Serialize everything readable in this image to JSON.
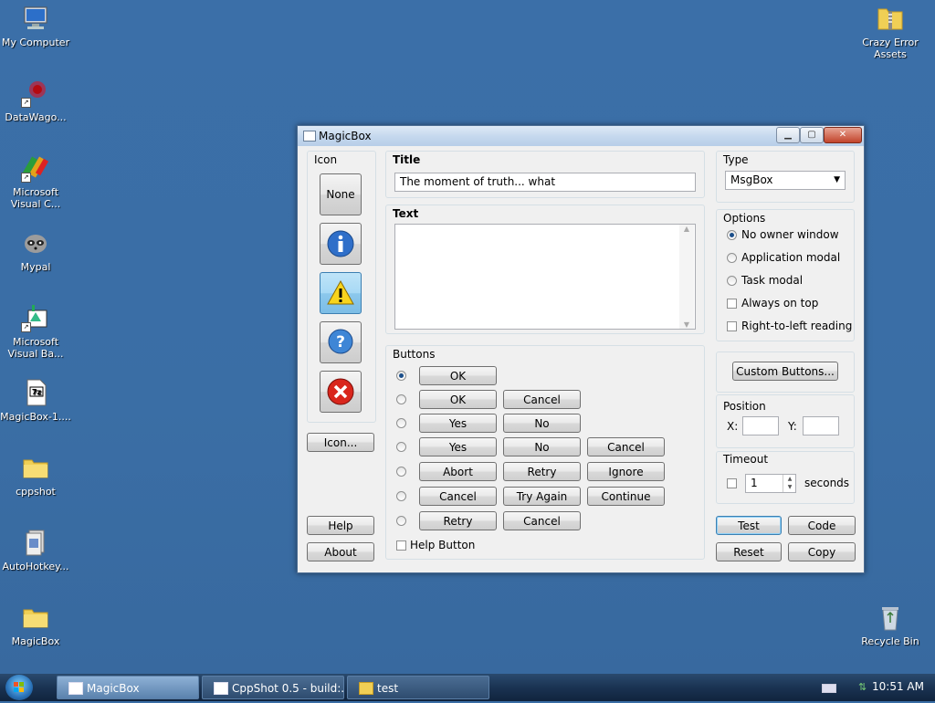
{
  "desktop": {
    "icons": [
      {
        "label": "My Computer",
        "icon": "computer-icon"
      },
      {
        "label": "DataWago...",
        "icon": "datawagon-icon"
      },
      {
        "label": "Microsoft Visual C...",
        "icon": "visual-c-icon"
      },
      {
        "label": "Mypal",
        "icon": "raccoon-icon"
      },
      {
        "label": "Microsoft Visual Ba...",
        "icon": "visual-basic-icon"
      },
      {
        "label": "MagicBox-1....",
        "icon": "7z-archive-icon"
      },
      {
        "label": "cppshot",
        "icon": "folder-icon"
      },
      {
        "label": "AutoHotkey...",
        "icon": "autohotkey-icon"
      },
      {
        "label": "MagicBox",
        "icon": "folder-icon"
      },
      {
        "label": "Crazy Error Assets",
        "icon": "zip-folder-icon"
      },
      {
        "label": "Recycle Bin",
        "icon": "recycle-bin-icon"
      }
    ]
  },
  "window": {
    "title": "MagicBox",
    "icon_group": {
      "label": "Icon",
      "none_label": "None",
      "icon_button_label": "Icon...",
      "help_label": "Help",
      "about_label": "About"
    },
    "title_field": {
      "label": "Title",
      "value": "The moment of truth... what"
    },
    "text_field": {
      "label": "Text",
      "value": ""
    },
    "buttons_group": {
      "label": "Buttons",
      "rows": [
        {
          "b1": "OK",
          "b2": "",
          "b3": ""
        },
        {
          "b1": "OK",
          "b2": "Cancel",
          "b3": ""
        },
        {
          "b1": "Yes",
          "b2": "No",
          "b3": ""
        },
        {
          "b1": "Yes",
          "b2": "No",
          "b3": "Cancel"
        },
        {
          "b1": "Abort",
          "b2": "Retry",
          "b3": "Ignore"
        },
        {
          "b1": "Cancel",
          "b2": "Try Again",
          "b3": "Continue"
        },
        {
          "b1": "Retry",
          "b2": "Cancel",
          "b3": ""
        }
      ],
      "help_button_label": "Help Button"
    },
    "type_group": {
      "label": "Type",
      "selected": "MsgBox"
    },
    "options_group": {
      "label": "Options",
      "no_owner": "No owner window",
      "app_modal": "Application modal",
      "task_modal": "Task modal",
      "always_on_top": "Always on top",
      "rtl": "Right-to-left reading"
    },
    "custom_buttons_label": "Custom Buttons...",
    "position_group": {
      "label": "Position",
      "x_label": "X:",
      "y_label": "Y:",
      "x_value": "",
      "y_value": ""
    },
    "timeout_group": {
      "label": "Timeout",
      "value": "1",
      "unit": "seconds"
    },
    "actions": {
      "test": "Test",
      "code": "Code",
      "reset": "Reset",
      "copy": "Copy"
    }
  },
  "taskbar": {
    "items": [
      {
        "label": "MagicBox"
      },
      {
        "label": "CppShot 0.5 - build:..."
      },
      {
        "label": "test"
      }
    ],
    "clock": "10:51 AM"
  }
}
